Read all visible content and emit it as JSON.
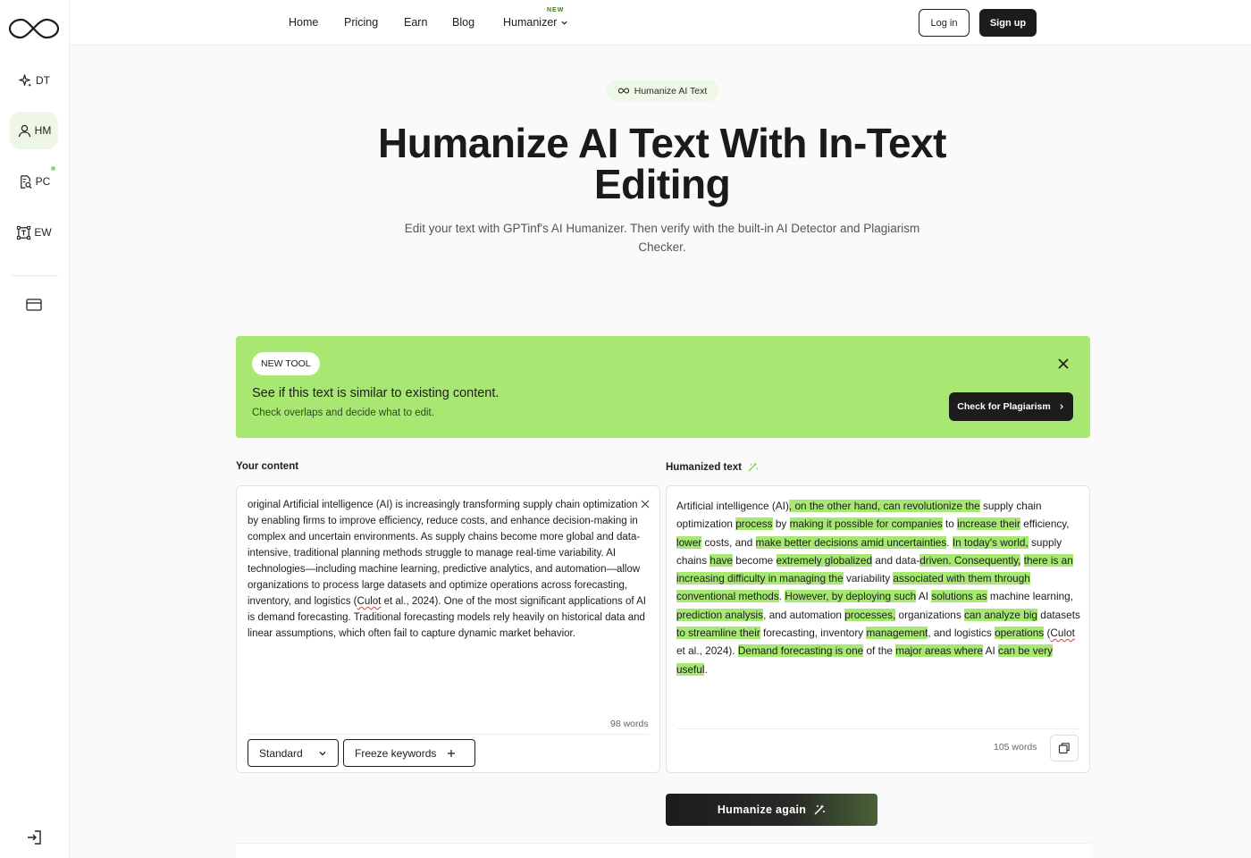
{
  "sidebar": {
    "items": [
      {
        "label": "DT",
        "icon": "sparkle-icon"
      },
      {
        "label": "HM",
        "icon": "user-icon"
      },
      {
        "label": "PC",
        "icon": "document-search-icon"
      },
      {
        "label": "EW",
        "icon": "text-frame-icon"
      }
    ]
  },
  "nav": {
    "links": [
      "Home",
      "Pricing",
      "Earn",
      "Blog",
      "Humanizer"
    ],
    "new_tag": "NEW",
    "login": "Log in",
    "signup": "Sign up"
  },
  "hero": {
    "pill": "Humanize AI Text",
    "title": "Humanize AI Text With In-Text Editing",
    "subtitle": "Edit your text with GPTinf's AI Humanizer. Then verify with the built-in AI Detector and Plagiarism Checker."
  },
  "banner": {
    "badge": "NEW TOOL",
    "title": "See if this text is similar to existing content.",
    "subtitle": "Check overlaps and decide what to edit.",
    "button": "Check for Plagiarism"
  },
  "input_panel": {
    "label": "Your content",
    "text_before": "original Artificial intelligence (AI) is increasingly transforming supply chain optimization by enabling firms to improve efficiency, reduce costs, and enhance decision-making in complex and uncertain environments. As supply chains become more global and data-intensive, traditional planning methods struggle to manage real-time variability. AI technologies—including machine learning, predictive analytics, and automation—allow organizations to process large datasets and optimize operations across forecasting, inventory, and logistics (",
    "citation_name": "Culot",
    "text_after": " et al., 2024). One of the most significant applications of AI is demand forecasting. Traditional forecasting models rely heavily on historical data and linear assumptions, which often fail to capture dynamic market behavior.",
    "word_count": "98 words",
    "mode": "Standard",
    "freeze": "Freeze keywords"
  },
  "output_panel": {
    "label": "Humanized text",
    "word_count": "105 words",
    "segments": [
      {
        "t": "Artificial intelligence (AI)",
        "h": false
      },
      {
        "t": ", on the other hand, can revolutionize the",
        "h": true
      },
      {
        "t": " supply chain optimization ",
        "h": false
      },
      {
        "t": "process",
        "h": true
      },
      {
        "t": " by ",
        "h": false
      },
      {
        "t": "making it possible for companies",
        "h": true
      },
      {
        "t": " to ",
        "h": false
      },
      {
        "t": "increase their",
        "h": true
      },
      {
        "t": " efficiency, ",
        "h": false
      },
      {
        "t": "lower",
        "h": true
      },
      {
        "t": " costs, and ",
        "h": false
      },
      {
        "t": "make better decisions amid uncertainties",
        "h": true
      },
      {
        "t": ". ",
        "h": false
      },
      {
        "t": "In today's world,",
        "h": true
      },
      {
        "t": " supply chains ",
        "h": false
      },
      {
        "t": "have",
        "h": true
      },
      {
        "t": " become ",
        "h": false
      },
      {
        "t": "extremely globalized",
        "h": true
      },
      {
        "t": " and data-",
        "h": false
      },
      {
        "t": "driven. Consequently,",
        "h": true
      },
      {
        "t": " ",
        "h": false
      },
      {
        "t": "there is an increasing difficulty in managing the",
        "h": true
      },
      {
        "t": " variability ",
        "h": false
      },
      {
        "t": "associated with them through conventional methods",
        "h": true
      },
      {
        "t": ". ",
        "h": false
      },
      {
        "t": "However, by deploying such",
        "h": true
      },
      {
        "t": " AI ",
        "h": false
      },
      {
        "t": "solutions as",
        "h": true
      },
      {
        "t": " machine learning, ",
        "h": false
      },
      {
        "t": "prediction analysis",
        "h": true
      },
      {
        "t": ", and automation ",
        "h": false
      },
      {
        "t": "processes,",
        "h": true
      },
      {
        "t": " organizations ",
        "h": false
      },
      {
        "t": "can analyze big",
        "h": true
      },
      {
        "t": " datasets ",
        "h": false
      },
      {
        "t": "to streamline their",
        "h": true
      },
      {
        "t": " forecasting, inventory ",
        "h": false
      },
      {
        "t": "management",
        "h": true
      },
      {
        "t": ", and logistics ",
        "h": false
      },
      {
        "t": "operations",
        "h": true
      },
      {
        "t": " (",
        "h": false
      },
      {
        "t": "Culot",
        "h": false,
        "s": true
      },
      {
        "t": " et al., 2024). ",
        "h": false
      },
      {
        "t": "Demand forecasting is one",
        "h": true
      },
      {
        "t": " of the ",
        "h": false
      },
      {
        "t": "major areas where",
        "h": true
      },
      {
        "t": " AI ",
        "h": false
      },
      {
        "t": "can be very useful",
        "h": true
      },
      {
        "t": ".",
        "h": false
      }
    ]
  },
  "actions": {
    "humanize_again": "Humanize again"
  },
  "colors": {
    "accent_green": "#a8e872",
    "highlight": "#a6e871",
    "dark": "#1c1c1c"
  }
}
